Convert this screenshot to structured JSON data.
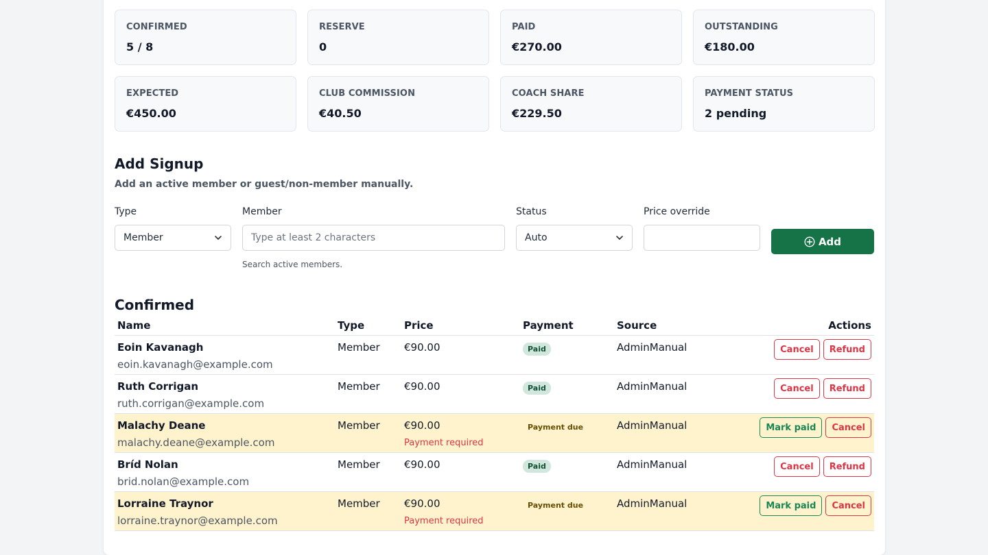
{
  "stats": [
    {
      "label": "CONFIRMED",
      "value": "5 / 8"
    },
    {
      "label": "RESERVE",
      "value": "0"
    },
    {
      "label": "PAID",
      "value": "€270.00"
    },
    {
      "label": "OUTSTANDING",
      "value": "€180.00"
    },
    {
      "label": "EXPECTED",
      "value": "€450.00"
    },
    {
      "label": "CLUB COMMISSION",
      "value": "€40.50"
    },
    {
      "label": "COACH SHARE",
      "value": "€229.50"
    },
    {
      "label": "PAYMENT STATUS",
      "value": "2 pending"
    }
  ],
  "add_signup": {
    "title": "Add Signup",
    "subtitle": "Add an active member or guest/non-member manually.",
    "type_label": "Type",
    "type_value": "Member",
    "member_label": "Member",
    "member_placeholder": "Type at least 2 characters",
    "member_help": "Search active members.",
    "status_label": "Status",
    "status_value": "Auto",
    "price_label": "Price override",
    "price_value": "",
    "add_label": "Add"
  },
  "confirmed": {
    "title": "Confirmed",
    "columns": {
      "name": "Name",
      "type": "Type",
      "price": "Price",
      "payment": "Payment",
      "source": "Source",
      "actions": "Actions"
    },
    "rows": [
      {
        "name": "Eoin Kavanagh",
        "email": "eoin.kavanagh@example.com",
        "type": "Member",
        "price": "€90.00",
        "note": "",
        "payment": "Paid",
        "source": "AdminManual",
        "action1": "Cancel",
        "action2": "Refund"
      },
      {
        "name": "Ruth Corrigan",
        "email": "ruth.corrigan@example.com",
        "type": "Member",
        "price": "€90.00",
        "note": "",
        "payment": "Paid",
        "source": "AdminManual",
        "action1": "Cancel",
        "action2": "Refund"
      },
      {
        "name": "Malachy Deane",
        "email": "malachy.deane@example.com",
        "type": "Member",
        "price": "€90.00",
        "note": "Payment required",
        "payment": "Payment due",
        "source": "AdminManual",
        "action1": "Mark paid",
        "action2": "Cancel"
      },
      {
        "name": "Bríd Nolan",
        "email": "brid.nolan@example.com",
        "type": "Member",
        "price": "€90.00",
        "note": "",
        "payment": "Paid",
        "source": "AdminManual",
        "action1": "Cancel",
        "action2": "Refund"
      },
      {
        "name": "Lorraine Traynor",
        "email": "lorraine.traynor@example.com",
        "type": "Member",
        "price": "€90.00",
        "note": "Payment required",
        "payment": "Payment due",
        "source": "AdminManual",
        "action1": "Mark paid",
        "action2": "Cancel"
      }
    ]
  },
  "colors": {
    "primary_green": "#157347",
    "danger": "#dc3545",
    "success": "#198754",
    "due_row_bg": "#fff3cd",
    "paid_badge_bg": "#d1e7dd"
  },
  "icons": {
    "add": "plus-circle-icon",
    "dropdown": "chevron-down-icon"
  }
}
